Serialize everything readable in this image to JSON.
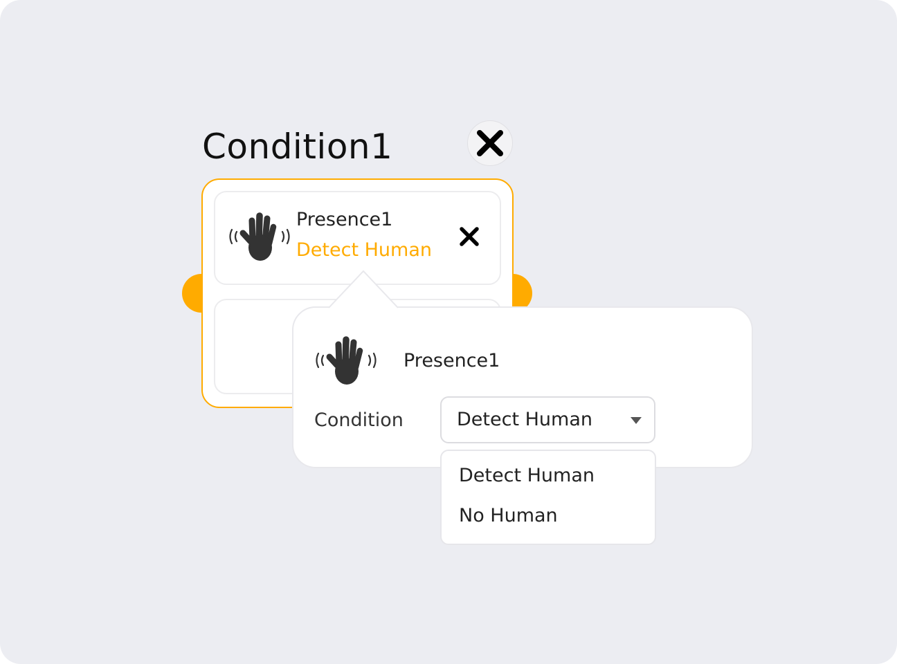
{
  "condition": {
    "title": "Condition1",
    "close_icon": "close-icon"
  },
  "colors": {
    "accent": "#ffab00",
    "background": "#ecedf2",
    "text": "#222222"
  },
  "sensor_slot": {
    "icon": "hand-wave-icon",
    "name": "Presence1",
    "condition": "Detect Human",
    "remove_icon": "close-icon"
  },
  "popover": {
    "icon": "hand-wave-icon",
    "device_name": "Presence1",
    "condition_label": "Condition",
    "selected_condition": "Detect Human",
    "dropdown_icon": "caret-down-icon",
    "options": [
      "Detect Human",
      "No Human"
    ]
  }
}
